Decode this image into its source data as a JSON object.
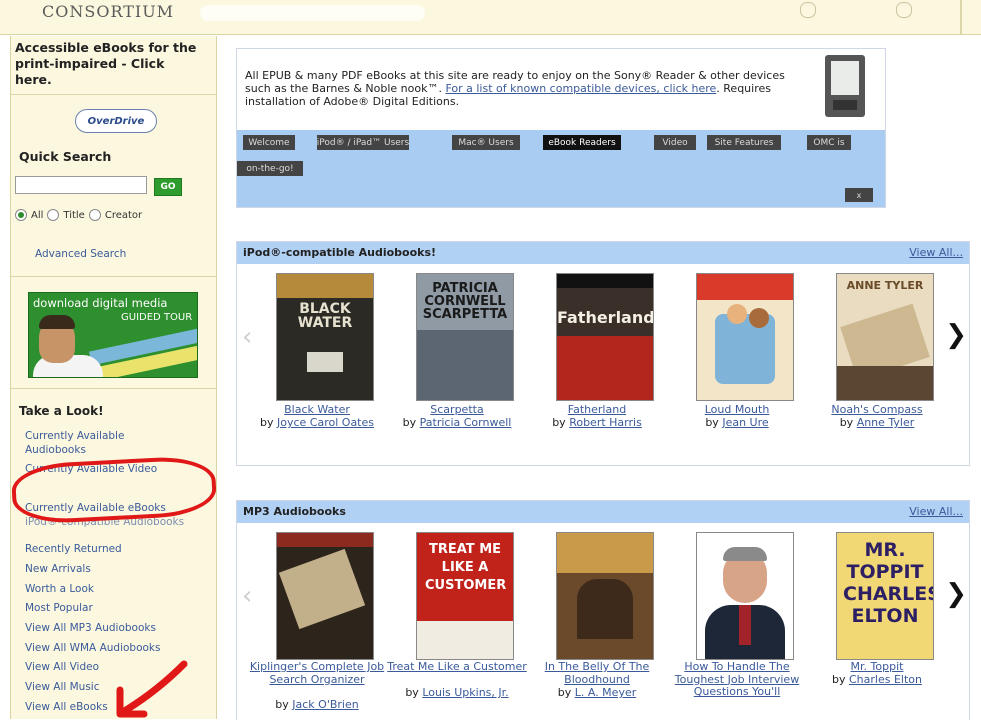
{
  "header": {
    "logo_text": "CONSORTIUM"
  },
  "sidebar": {
    "accessible_lines": [
      "Accessible eBooks for the",
      "print-impaired - Click",
      "here."
    ],
    "overdrive_logo": "OverDrive",
    "quick_search_title": "Quick Search",
    "search_value": "",
    "go_label": "GO",
    "radio_all": "All",
    "radio_title": "Title",
    "radio_creator": "Creator",
    "advanced_search": "Advanced Search",
    "promo_line1": "download digital media",
    "promo_line2": "GUIDED TOUR",
    "take_a_look_title": "Take a Look!",
    "links": [
      "Currently Available Audiobooks",
      "Currently Available Video",
      "Currently Available eBooks",
      "iPod®-compatible Audiobooks",
      "Recently Returned",
      "New Arrivals",
      "Worth a Look",
      "Most Popular",
      "View All MP3 Audiobooks",
      "View All WMA Audiobooks",
      "View All Video",
      "View All Music",
      "View All eBooks"
    ],
    "annotation_color": "#e01818"
  },
  "info_box": {
    "text_part1": "All EPUB & many PDF eBooks at this site are ready to enjoy on the Sony® Reader & other devices such as the Barnes & Noble nook™.",
    "link_text": "For a list of known compatible devices, click here",
    "text_part2": ". Requires installation of Adobe® Digital Editions.",
    "tabs": [
      "Welcome",
      "iPod® / iPad™ Users",
      "Mac® Users",
      "eBook Readers",
      "Video",
      "Site Features",
      "OMC is",
      "on-the-go!"
    ],
    "active_tab": "eBook Readers",
    "close_label": "x",
    "tab_bg_color": "#a8ccf2"
  },
  "ipod_section": {
    "title": "iPod®-compatible Audiobooks!",
    "view_all": "View All...",
    "books": [
      {
        "title": "Black Water",
        "by": "by",
        "author": "Joyce Carol Oates",
        "cover_text": "BLACK WATER"
      },
      {
        "title": "Scarpetta",
        "by": "by",
        "author": "Patricia Cornwell",
        "cover_text": "PATRICIA CORNWELL SCARPETTA"
      },
      {
        "title": "Fatherland",
        "by": "by",
        "author": "Robert Harris",
        "cover_text": "Fatherland"
      },
      {
        "title": "Loud Mouth",
        "by": "by",
        "author": "Jean Ure",
        "cover_text": ""
      },
      {
        "title": "Noah's Compass",
        "by": "by",
        "author": "Anne Tyler",
        "cover_text": "ANNE TYLER"
      }
    ]
  },
  "mp3_section": {
    "title": "MP3 Audiobooks",
    "view_all": "View All...",
    "books": [
      {
        "title": "Kiplinger's Complete Job Search Organizer",
        "by": "by",
        "author": "Jack O'Brien"
      },
      {
        "title": "Treat Me Like a Customer",
        "by": "by",
        "author": "Louis Upkins, Jr.",
        "cover_text": "TREAT ME LIKE A CUSTOMER"
      },
      {
        "title": "In The Belly Of The Bloodhound",
        "by": "by",
        "author": "L. A. Meyer"
      },
      {
        "title": "How To Handle The Toughest Job Interview Questions You'll",
        "by": "",
        "author": ""
      },
      {
        "title": "Mr. Toppit",
        "by": "by",
        "author": "Charles Elton",
        "cover_text": "MR. TOPPIT CHARLES ELTON"
      }
    ]
  }
}
